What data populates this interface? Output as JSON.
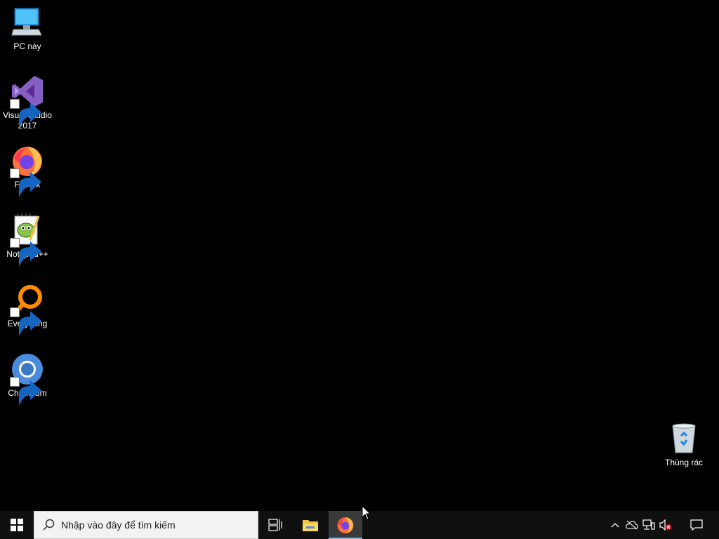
{
  "desktop": {
    "icons": [
      {
        "id": "pc",
        "label": "PC này",
        "icon": "computer-icon"
      },
      {
        "id": "vs",
        "label": "Visual Studio 2017",
        "icon": "visual-studio-icon"
      },
      {
        "id": "firefox",
        "label": "Firefox",
        "icon": "firefox-icon"
      },
      {
        "id": "notepadpp",
        "label": "Notepad++",
        "icon": "notepad-plus-plus-icon"
      },
      {
        "id": "everything",
        "label": "Everything",
        "icon": "everything-search-icon"
      },
      {
        "id": "chromium",
        "label": "Chromium",
        "icon": "chromium-icon"
      },
      {
        "id": "recycle",
        "label": "Thùng rác",
        "icon": "recycle-bin-icon"
      }
    ]
  },
  "taskbar": {
    "search_placeholder": "Nhập vào đây để tìm kiếm",
    "pinned": [
      {
        "id": "task-view",
        "icon": "task-view-icon",
        "active": false
      },
      {
        "id": "file-explorer",
        "icon": "folder-icon",
        "active": false
      },
      {
        "id": "firefox",
        "icon": "firefox-icon",
        "active": true
      }
    ],
    "tray": [
      {
        "id": "show-hidden",
        "icon": "chevron-up-icon"
      },
      {
        "id": "onedrive",
        "icon": "cloud-off-icon"
      },
      {
        "id": "network",
        "icon": "network-icon"
      },
      {
        "id": "volume",
        "icon": "volume-muted-icon"
      },
      {
        "id": "notifications",
        "icon": "notification-icon"
      }
    ]
  },
  "colors": {
    "desktop_bg": "#000000",
    "taskbar_bg": "#101010",
    "active_indicator": "#7eb4ea"
  }
}
